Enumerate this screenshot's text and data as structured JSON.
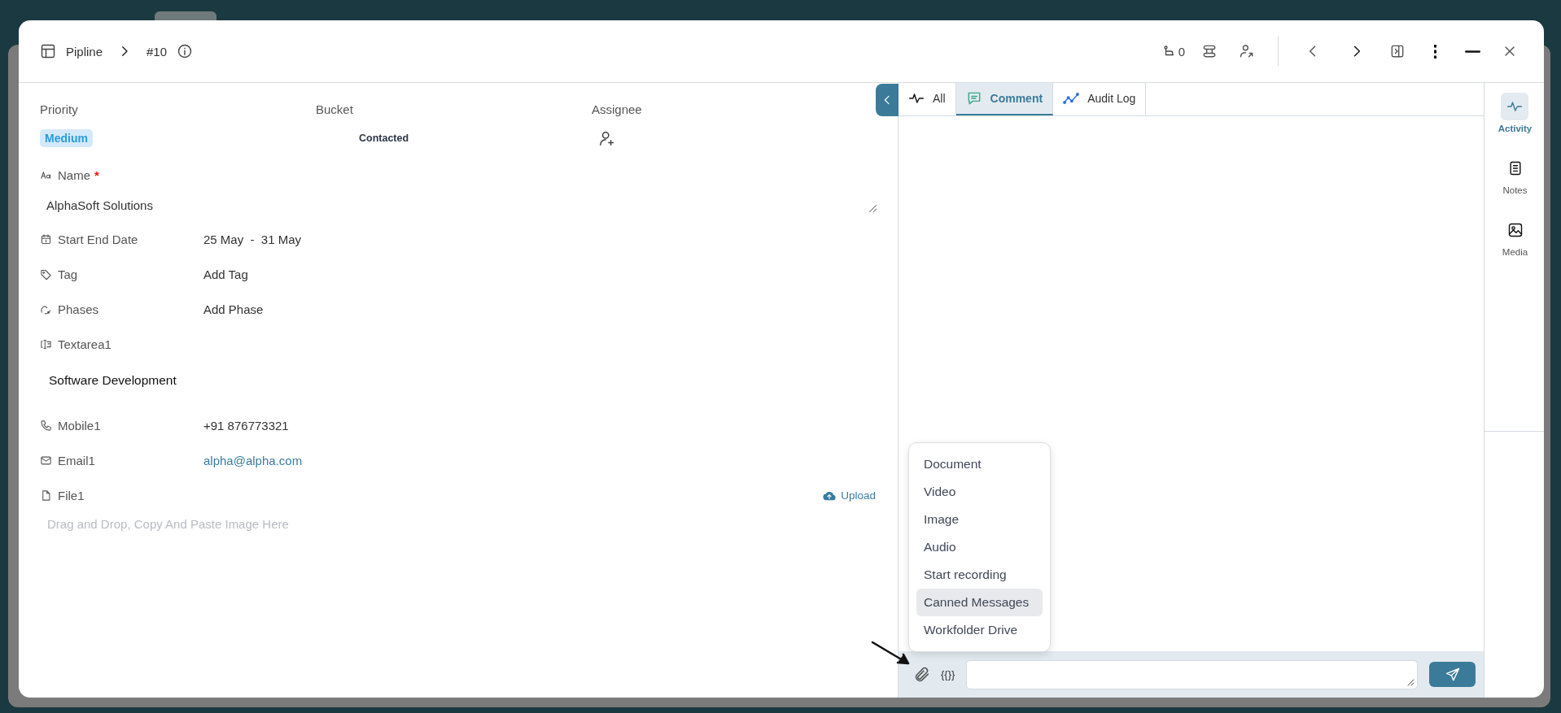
{
  "header": {
    "breadcrumb_root": "Pipline",
    "record_id": "#10",
    "follower_count": "0"
  },
  "top_fields": [
    {
      "kind": "badge",
      "label": "Priority",
      "value": "Medium"
    },
    {
      "kind": "text",
      "label": "Bucket",
      "value": "Contacted"
    },
    {
      "kind": "assign",
      "label": "Assignee"
    }
  ],
  "fields": [
    {
      "kind": "name",
      "label": "Name",
      "marker": "*",
      "value": "AlphaSoft Solutions"
    },
    {
      "kind": "date",
      "label": "Start End Date",
      "value": "25 May  -  31 May"
    },
    {
      "kind": "tag",
      "label": "Tag",
      "action": "Add Tag"
    },
    {
      "kind": "phase",
      "label": "Phases",
      "action": "Add Phase"
    },
    {
      "kind": "textarea",
      "label": "Textarea1",
      "value": "Software Development"
    },
    {
      "kind": "phone",
      "label": "Mobile1",
      "value": "+91 876773321"
    },
    {
      "kind": "email",
      "label": "Email1",
      "value": "alpha@alpha.com"
    },
    {
      "kind": "file",
      "label": "File1",
      "upload": "Upload",
      "hint": "Drag and Drop, Copy And Paste Image Here"
    }
  ],
  "tabs": [
    {
      "kind": "all",
      "label": "All",
      "selected": false
    },
    {
      "kind": "comment",
      "label": "Comment",
      "selected": true
    },
    {
      "kind": "audit",
      "label": "Audit Log",
      "selected": false
    }
  ],
  "attach_menu": [
    {
      "label": "Document",
      "selected": false
    },
    {
      "label": "Video",
      "selected": false
    },
    {
      "label": "Image",
      "selected": false
    },
    {
      "label": "Audio",
      "selected": false
    },
    {
      "label": "Start recording",
      "selected": false
    },
    {
      "label": "Canned Messages",
      "selected": true
    },
    {
      "label": "Workfolder Drive",
      "selected": false
    }
  ],
  "composer": {
    "variables_label": "{{}}"
  },
  "side_tabs": [
    {
      "kind": "activity",
      "label": "Activity",
      "selected": true
    },
    {
      "kind": "notes",
      "label": "Notes",
      "selected": false
    },
    {
      "kind": "media",
      "label": "Media",
      "selected": false
    }
  ]
}
